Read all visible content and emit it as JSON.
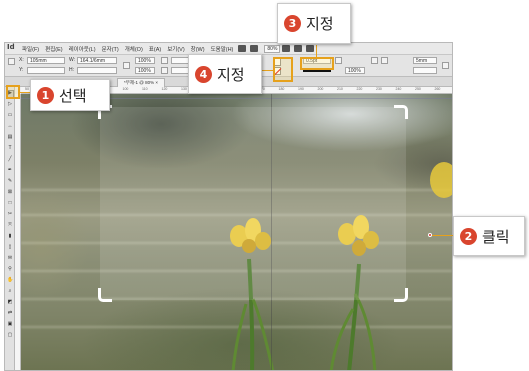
{
  "colors": {
    "badge": "#d9452e",
    "highlight": "#e6a11c",
    "frame_corner": "#ffffff",
    "flower_yellow": "#e8c63a",
    "stem_green": "#4d7a2c"
  },
  "menubar": {
    "logo": "Id",
    "items": [
      "파일(F)",
      "편집(E)",
      "레이아웃(L)",
      "문자(T)",
      "개체(O)",
      "표(A)",
      "보기(V)",
      "창(W)",
      "도움말(H)"
    ],
    "zoom": "80%",
    "icons": [
      "bridge-icon",
      "minibridge-icon",
      "view-options-icon",
      "screen-mode-icon",
      "arrange-icon"
    ]
  },
  "control": {
    "x_label": "X:",
    "x_value": "105mm",
    "y_label": "Y:",
    "y_value": "",
    "w_label": "W:",
    "w_value": "164.1/6mm",
    "h_label": "H:",
    "h_value": "",
    "scale_x": "100%",
    "scale_y": "100%",
    "angle": "",
    "shear": "",
    "stroke_weight": "0.5pt",
    "opacity": "100%",
    "size_right": "5mm"
  },
  "document_tab": "*무제-1 @ 80% ×",
  "ruler_numbers": [
    "50",
    "60",
    "70",
    "80",
    "90",
    "100",
    "110",
    "120",
    "130",
    "140",
    "150",
    "160",
    "170",
    "180",
    "190",
    "200",
    "210",
    "220",
    "230",
    "240",
    "250",
    "260"
  ],
  "toolbox": {
    "tools": [
      "selection-tool-icon",
      "direct-selection-tool-icon",
      "page-tool-icon",
      "gap-tool-icon",
      "content-collector-icon",
      "type-tool-icon",
      "line-tool-icon",
      "pen-tool-icon",
      "pencil-tool-icon",
      "rectangle-frame-tool-icon",
      "rectangle-tool-icon",
      "scissors-tool-icon",
      "free-transform-tool-icon",
      "gradient-swatch-tool-icon",
      "gradient-feather-tool-icon",
      "note-tool-icon",
      "eyedropper-tool-icon",
      "hand-tool-icon",
      "zoom-tool-icon",
      "fill-stroke-icon",
      "swap-icon",
      "formatting-icon",
      "view-mode-icon"
    ]
  },
  "callouts": {
    "c1": {
      "num": "1",
      "text": "선택"
    },
    "c2": {
      "num": "2",
      "text": "클릭"
    },
    "c3": {
      "num": "3",
      "text": "지정"
    },
    "c4": {
      "num": "4",
      "text": "지정"
    }
  }
}
